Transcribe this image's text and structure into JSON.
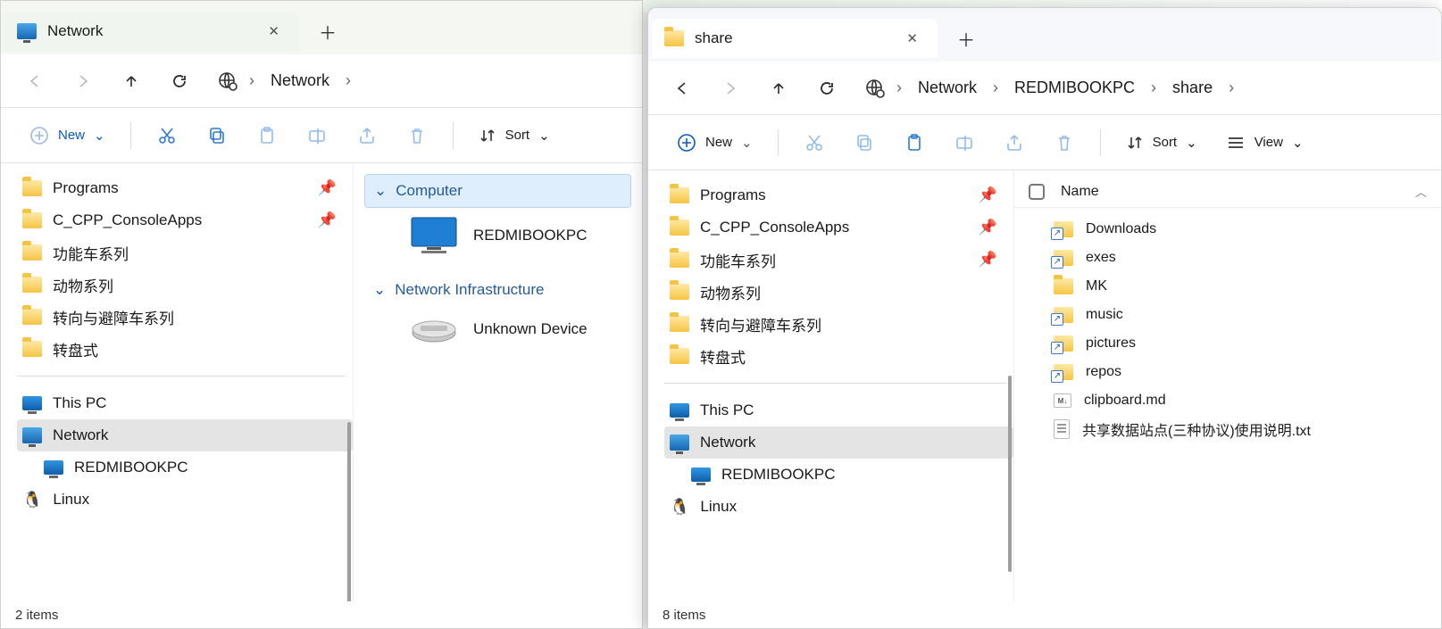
{
  "left": {
    "tab_title": "Network",
    "breadcrumbs": [
      "Network"
    ],
    "toolbar": {
      "new": "New",
      "sort": "Sort"
    },
    "nav": {
      "pinned": [
        {
          "label": "Programs",
          "pin": true
        },
        {
          "label": "C_CPP_ConsoleApps",
          "pin": true
        },
        {
          "label": "功能车系列"
        },
        {
          "label": "动物系列"
        },
        {
          "label": "转向与避障车系列"
        },
        {
          "label": "转盘式"
        }
      ],
      "tree": [
        {
          "label": "This PC",
          "kind": "pc"
        },
        {
          "label": "Network",
          "kind": "net",
          "selected": true
        },
        {
          "label": "REDMIBOOKPC",
          "kind": "pc",
          "indent": true
        },
        {
          "label": "Linux",
          "kind": "penguin"
        }
      ]
    },
    "groups": [
      {
        "header": "Computer",
        "selected": true,
        "items": [
          {
            "label": "REDMIBOOKPC",
            "kind": "monitor"
          }
        ]
      },
      {
        "header": "Network Infrastructure",
        "items": [
          {
            "label": "Unknown Device",
            "kind": "router"
          }
        ]
      }
    ],
    "status": "2 items"
  },
  "right": {
    "tab_title": "share",
    "breadcrumbs": [
      "Network",
      "REDMIBOOKPC",
      "share"
    ],
    "toolbar": {
      "new": "New",
      "sort": "Sort",
      "view": "View"
    },
    "nav": {
      "pinned": [
        {
          "label": "Programs",
          "pin": true
        },
        {
          "label": "C_CPP_ConsoleApps",
          "pin": true
        },
        {
          "label": "功能车系列",
          "pin": true
        },
        {
          "label": "动物系列"
        },
        {
          "label": "转向与避障车系列"
        },
        {
          "label": "转盘式"
        }
      ],
      "tree": [
        {
          "label": "This PC",
          "kind": "pc"
        },
        {
          "label": "Network",
          "kind": "net",
          "selected": true
        },
        {
          "label": "REDMIBOOKPC",
          "kind": "pc",
          "indent": true
        },
        {
          "label": "Linux",
          "kind": "penguin"
        }
      ]
    },
    "columns": {
      "name": "Name"
    },
    "files": [
      {
        "label": "Downloads",
        "kind": "folder-sh"
      },
      {
        "label": "exes",
        "kind": "folder-sh"
      },
      {
        "label": "MK",
        "kind": "folder"
      },
      {
        "label": "music",
        "kind": "folder-sh"
      },
      {
        "label": "pictures",
        "kind": "folder-sh"
      },
      {
        "label": "repos",
        "kind": "folder-sh"
      },
      {
        "label": "clipboard.md",
        "kind": "md"
      },
      {
        "label": "共享数据站点(三种协议)使用说明.txt",
        "kind": "txt"
      }
    ],
    "status": "8 items"
  }
}
